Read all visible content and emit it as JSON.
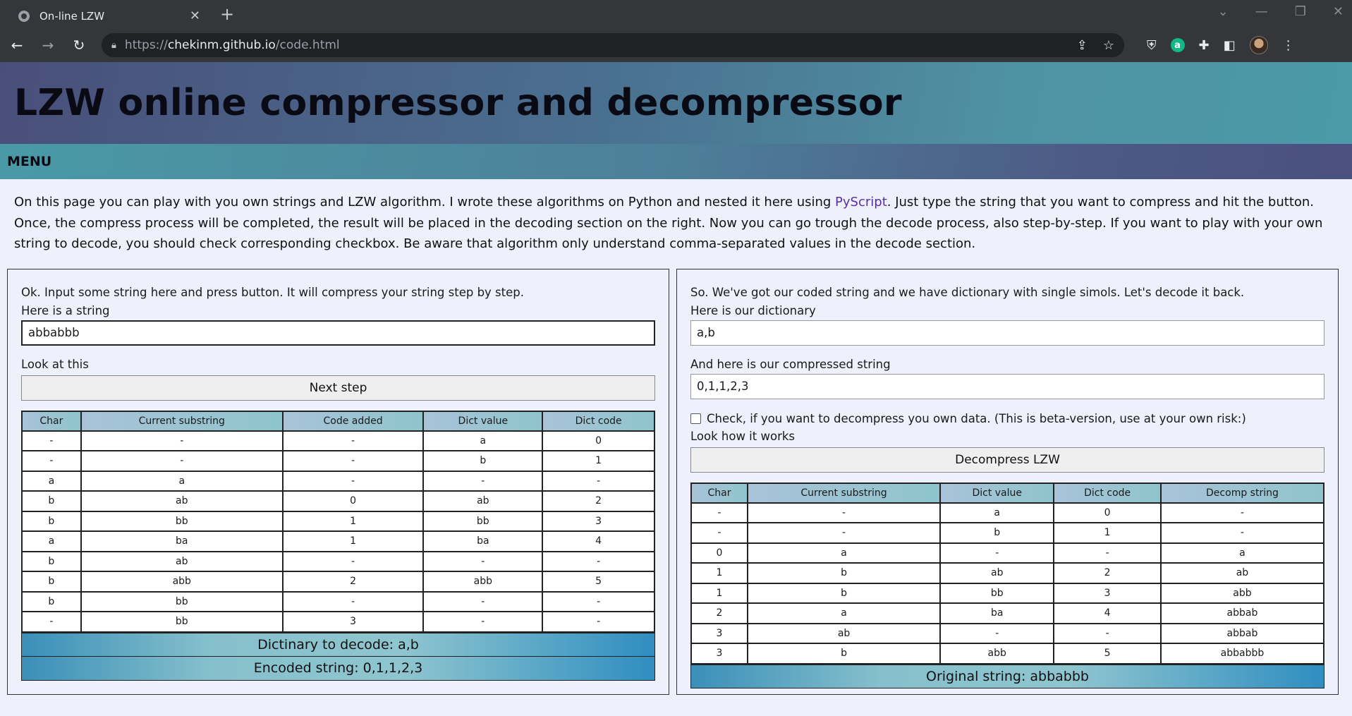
{
  "browser": {
    "tab_title": "On-line LZW",
    "url_proto": "https://",
    "url_host": "chekinm.github.io",
    "url_path": "/code.html"
  },
  "page": {
    "title": "LZW online compressor and decompressor",
    "menu_label": "MENU",
    "intro_before_link": "On this page you can play with you own strings and LZW algorithm. I wrote these algorithms on Python and nested it here using ",
    "intro_link": "PyScript",
    "intro_after_link": ". Just type the string that you want to compress and hit the button. Once, the compress process will be completed, the result will be placed in the decoding section on the right. Now you can go trough the decode process, also step-by-step. If you want to play with your own string to decode, you should check corresponding checkbox. Be aware that algorithm only understand comma-separated values in the decode section."
  },
  "compress": {
    "intro": "Ok. Input some string here and press button. It will compress your string step by step.",
    "string_label": "Here is a string",
    "string_value": "abbabbb",
    "look_label": "Look at this",
    "button_label": "Next step",
    "columns": [
      "Char",
      "Current substring",
      "Code added",
      "Dict value",
      "Dict code"
    ],
    "rows": [
      [
        "-",
        "-",
        "-",
        "a",
        "0"
      ],
      [
        "-",
        "-",
        "-",
        "b",
        "1"
      ],
      [
        "a",
        "a",
        "-",
        "-",
        "-"
      ],
      [
        "b",
        "ab",
        "0",
        "ab",
        "2"
      ],
      [
        "b",
        "bb",
        "1",
        "bb",
        "3"
      ],
      [
        "a",
        "ba",
        "1",
        "ba",
        "4"
      ],
      [
        "b",
        "ab",
        "-",
        "-",
        "-"
      ],
      [
        "b",
        "abb",
        "2",
        "abb",
        "5"
      ],
      [
        "b",
        "bb",
        "-",
        "-",
        "-"
      ],
      [
        "-",
        "bb",
        "3",
        "-",
        "-"
      ]
    ],
    "dict_result": "Dictinary to decode: a,b",
    "encoded_result": "Encoded string: 0,1,1,2,3"
  },
  "decompress": {
    "intro": "So. We've got our coded string and we have dictionary with single simols. Let's decode it back.",
    "dict_label": "Here is our dictionary",
    "dict_value": "a,b",
    "compressed_label": "And here is our compressed string",
    "compressed_value": "0,1,1,2,3",
    "checkbox_label": "Check, if you want to decompress you own data. (This is beta-version, use at your own risk:)",
    "look_label": "Look how it works",
    "button_label": "Decompress LZW",
    "columns": [
      "Char",
      "Current substring",
      "Dict value",
      "Dict code",
      "Decomp string"
    ],
    "rows": [
      [
        "-",
        "-",
        "a",
        "0",
        "-"
      ],
      [
        "-",
        "-",
        "b",
        "1",
        "-"
      ],
      [
        "0",
        "a",
        "-",
        "-",
        "a"
      ],
      [
        "1",
        "b",
        "ab",
        "2",
        "ab"
      ],
      [
        "1",
        "b",
        "bb",
        "3",
        "abb"
      ],
      [
        "2",
        "a",
        "ba",
        "4",
        "abbab"
      ],
      [
        "3",
        "ab",
        "-",
        "-",
        "abbab"
      ],
      [
        "3",
        "b",
        "abb",
        "5",
        "abbabbb"
      ]
    ],
    "original_result": "Original string: abbabbb"
  }
}
